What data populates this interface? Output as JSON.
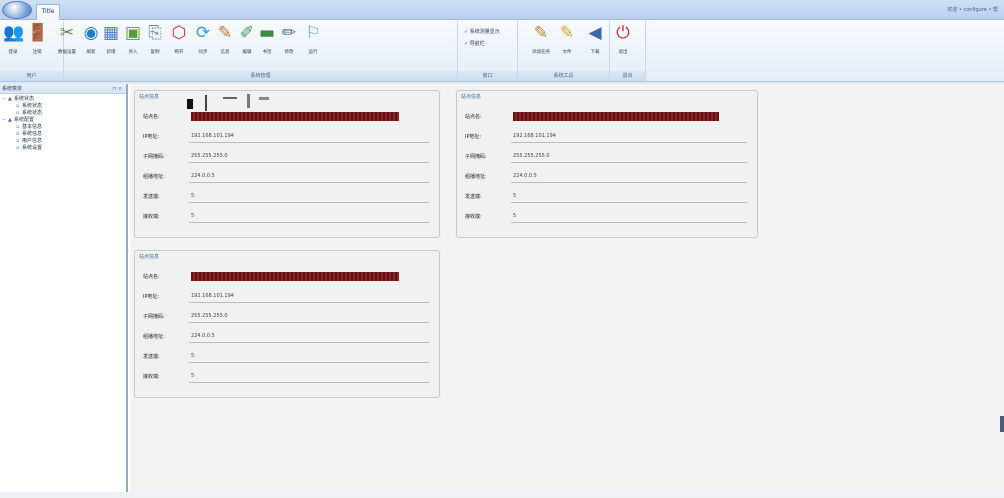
{
  "titlebar": {
    "tab": "Title",
    "user_info": "欢迎 • configure • 帮"
  },
  "ribbon": {
    "groups": [
      {
        "label": "用户"
      },
      {
        "label": "系统管理"
      },
      {
        "label": "窗口"
      },
      {
        "label": "系统工具"
      },
      {
        "label": "退出"
      }
    ],
    "buttons": [
      {
        "label": "登录",
        "icon": "users-icon",
        "glyph": "👥",
        "color": "#3a73c4"
      },
      {
        "label": "注销",
        "icon": "logout-icon",
        "glyph": "🚪",
        "color": "#caa23a"
      },
      {
        "label": "数据设置",
        "icon": "tools-icon",
        "glyph": "✂",
        "color": "#5a8f3a"
      },
      {
        "label": "刷新",
        "icon": "refresh-icon",
        "glyph": "◉",
        "color": "#1f7fcc"
      },
      {
        "label": "新增",
        "icon": "list-icon",
        "glyph": "▦",
        "color": "#4a7dc8"
      },
      {
        "label": "导入",
        "icon": "import-icon",
        "glyph": "▣",
        "color": "#5aa03a"
      },
      {
        "label": "复制",
        "icon": "copy-icon",
        "glyph": "⎘",
        "color": "#6a8db0"
      },
      {
        "label": "断开",
        "icon": "stop-icon",
        "glyph": "⬡",
        "color": "#d8262f"
      },
      {
        "label": "同步",
        "icon": "sync-icon",
        "glyph": "⟳",
        "color": "#3a9fd8"
      },
      {
        "label": "信息",
        "icon": "info-icon",
        "glyph": "✎",
        "color": "#c8762a"
      },
      {
        "label": "编辑",
        "icon": "edit-icon",
        "glyph": "✐",
        "color": "#3a9a5a"
      },
      {
        "label": "书签",
        "icon": "bookmark-icon",
        "glyph": "▬",
        "color": "#3c8a3c"
      },
      {
        "label": "修改",
        "icon": "pen-icon",
        "glyph": "✏",
        "color": "#4a6a9a"
      },
      {
        "label": "运行",
        "icon": "run-icon",
        "glyph": "⚐",
        "color": "#6aa2d8"
      },
      {
        "label": "添加任务",
        "icon": "task-icon",
        "glyph": "✎",
        "color": "#b58a2a"
      },
      {
        "label": "文件",
        "icon": "folder-icon",
        "glyph": "✎",
        "color": "#e0a020"
      },
      {
        "label": "下载",
        "icon": "download-icon",
        "glyph": "◀",
        "color": "#3a6aa8"
      },
      {
        "label": "退出",
        "icon": "exit-icon",
        "glyph": "⏻",
        "color": "#d8262f"
      }
    ],
    "checkboxes": [
      {
        "label": "✓ 系统测量显示"
      },
      {
        "label": "✓ 导航栏"
      }
    ]
  },
  "nav": {
    "header": "系统菜单",
    "pin": "⊓ ×",
    "items": [
      {
        "label": "系统状态",
        "level": 0,
        "toggle": "−"
      },
      {
        "label": "系统状态",
        "level": 1,
        "toggle": ""
      },
      {
        "label": "系统状态",
        "level": 1,
        "toggle": ""
      },
      {
        "label": "系统配置",
        "level": 0,
        "toggle": "−"
      },
      {
        "label": "基本信息",
        "level": 1,
        "toggle": ""
      },
      {
        "label": "系统信息",
        "level": 1,
        "toggle": ""
      },
      {
        "label": "用户信息",
        "level": 1,
        "toggle": ""
      },
      {
        "label": "系统设置",
        "level": 1,
        "toggle": ""
      }
    ]
  },
  "panels": [
    {
      "title": "站点信息",
      "rows": [
        {
          "key": "站点名:",
          "value": ""
        },
        {
          "key": "IP地址:",
          "value": "192.168.101.194"
        },
        {
          "key": "子网掩码:",
          "value": "255.255.255.0"
        },
        {
          "key": "组播地址:",
          "value": "224.0.0.5"
        },
        {
          "key": "发送端:",
          "value": "5"
        },
        {
          "key": "接收端:",
          "value": "5"
        }
      ]
    },
    {
      "title": "站点信息",
      "rows": [
        {
          "key": "站点名:",
          "value": ""
        },
        {
          "key": "IP地址:",
          "value": "192.168.101.194"
        },
        {
          "key": "子网掩码:",
          "value": "255.255.255.0"
        },
        {
          "key": "组播地址:",
          "value": "224.0.0.5"
        },
        {
          "key": "发送端:",
          "value": "5"
        },
        {
          "key": "接收端:",
          "value": "5"
        }
      ]
    },
    {
      "title": "站点信息",
      "rows": [
        {
          "key": "站点名:",
          "value": ""
        },
        {
          "key": "IP地址:",
          "value": "192.168.101.194"
        },
        {
          "key": "子网掩码:",
          "value": "255.255.255.0"
        },
        {
          "key": "组播地址:",
          "value": "224.0.0.5"
        },
        {
          "key": "发送端:",
          "value": "5"
        },
        {
          "key": "接收端:",
          "value": "5"
        }
      ]
    }
  ],
  "colors": {
    "redacted": "#6b1a1a",
    "panel_title": "#3a66a8"
  }
}
